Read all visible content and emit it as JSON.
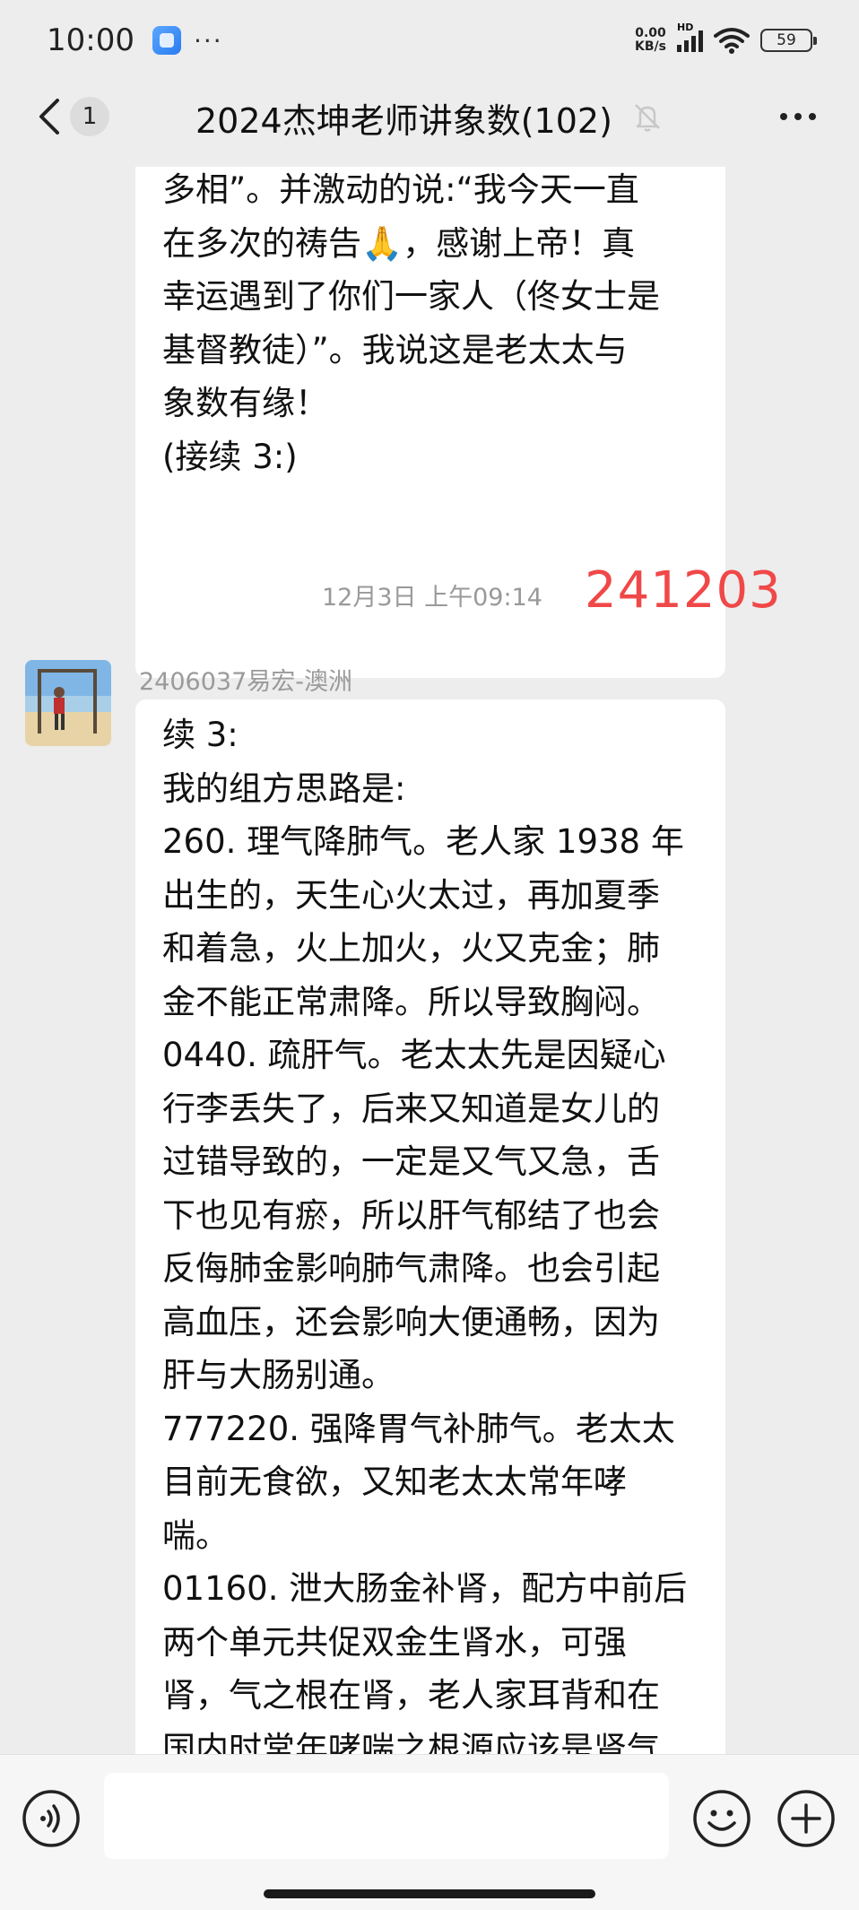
{
  "status_bar": {
    "time": "10:00",
    "dots": "···",
    "net_speed_value": "0.00",
    "net_speed_unit": "KB/s",
    "signal_label": "HD",
    "battery": "59"
  },
  "header": {
    "back_icon": "chevron-left-icon",
    "unread_count": "1",
    "title": "2024杰坤老师讲象数(102)",
    "mute_icon": "bell-off-icon",
    "more_icon": "more-horizontal-icon"
  },
  "messages": [
    {
      "lines": [
        "多相”。并激动的说:“我今天一直",
        "在多次的祷告🙏，感谢上帝！真",
        "幸运遇到了你们一家人（佟女士是",
        "基督教徒）”。我说这是老太太与",
        "象数有缘！",
        "(接续 3:)"
      ]
    },
    {
      "timestamp": "12月3日 上午09:14",
      "annotation": "241203",
      "sender": "2406037易宏-澳洲",
      "lines": [
        "续 3:",
        "我的组方思路是:",
        "260.  理气降肺气。老人家 1938 年",
        "出生的，天生心火太过，再加夏季",
        "和着急，火上加火，火又克金；肺",
        "金不能正常肃降。所以导致胸闷。",
        "0440. 疏肝气。老太太先是因疑心",
        "行李丢失了，后来又知道是女儿的",
        "过错导致的，一定是又气又急，舌",
        "下也见有瘀，所以肝气郁结了也会",
        "反侮肺金影响肺气肃降。也会引起",
        "高血压，还会影响大便通畅，因为",
        "肝与大肠别通。",
        "777220. 强降胃气补肺气。老太太",
        "目前无食欲，又知老太太常年哮",
        "喘。",
        "01160. 泄大肠金补肾，配方中前后",
        "两个单元共促双金生肾水，可强",
        "肾，气之根在肾，老人家耳背和在",
        "国内时常年哮喘之根源应该是肾气"
      ]
    }
  ],
  "input_bar": {
    "voice_icon": "voice-icon",
    "emoji_icon": "emoji-icon",
    "plus_icon": "plus-circle-icon"
  },
  "colors": {
    "background": "#ededed",
    "bubble": "#ffffff",
    "annotation": "#f04848"
  }
}
